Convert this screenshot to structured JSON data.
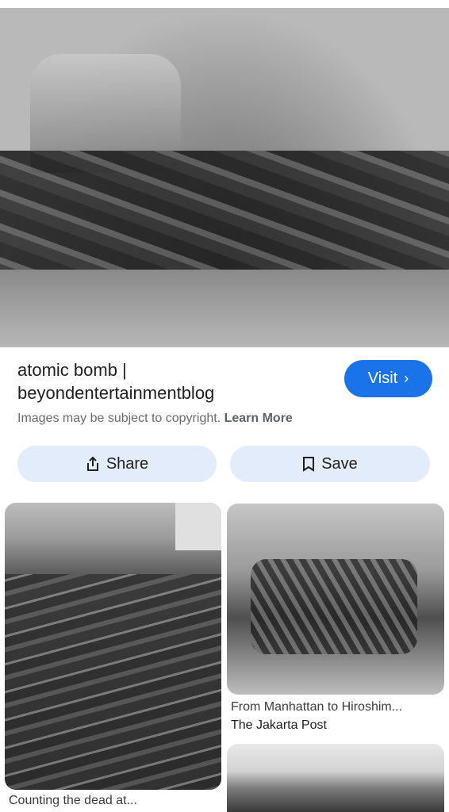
{
  "result": {
    "title": "atomic bomb | beyondentertainmentblog",
    "visit_label": "Visit",
    "copyright_text": "Images may be subject to copyright.",
    "learn_more": "Learn More"
  },
  "actions": {
    "share_label": "Share",
    "save_label": "Save"
  },
  "related": [
    {
      "caption": "Counting the dead at..."
    },
    {
      "caption": "From Manhattan to Hiroshim...",
      "source": "The Jakarta Post"
    }
  ],
  "colors": {
    "accent": "#1a73e8",
    "pill": "#e3ecfb"
  }
}
